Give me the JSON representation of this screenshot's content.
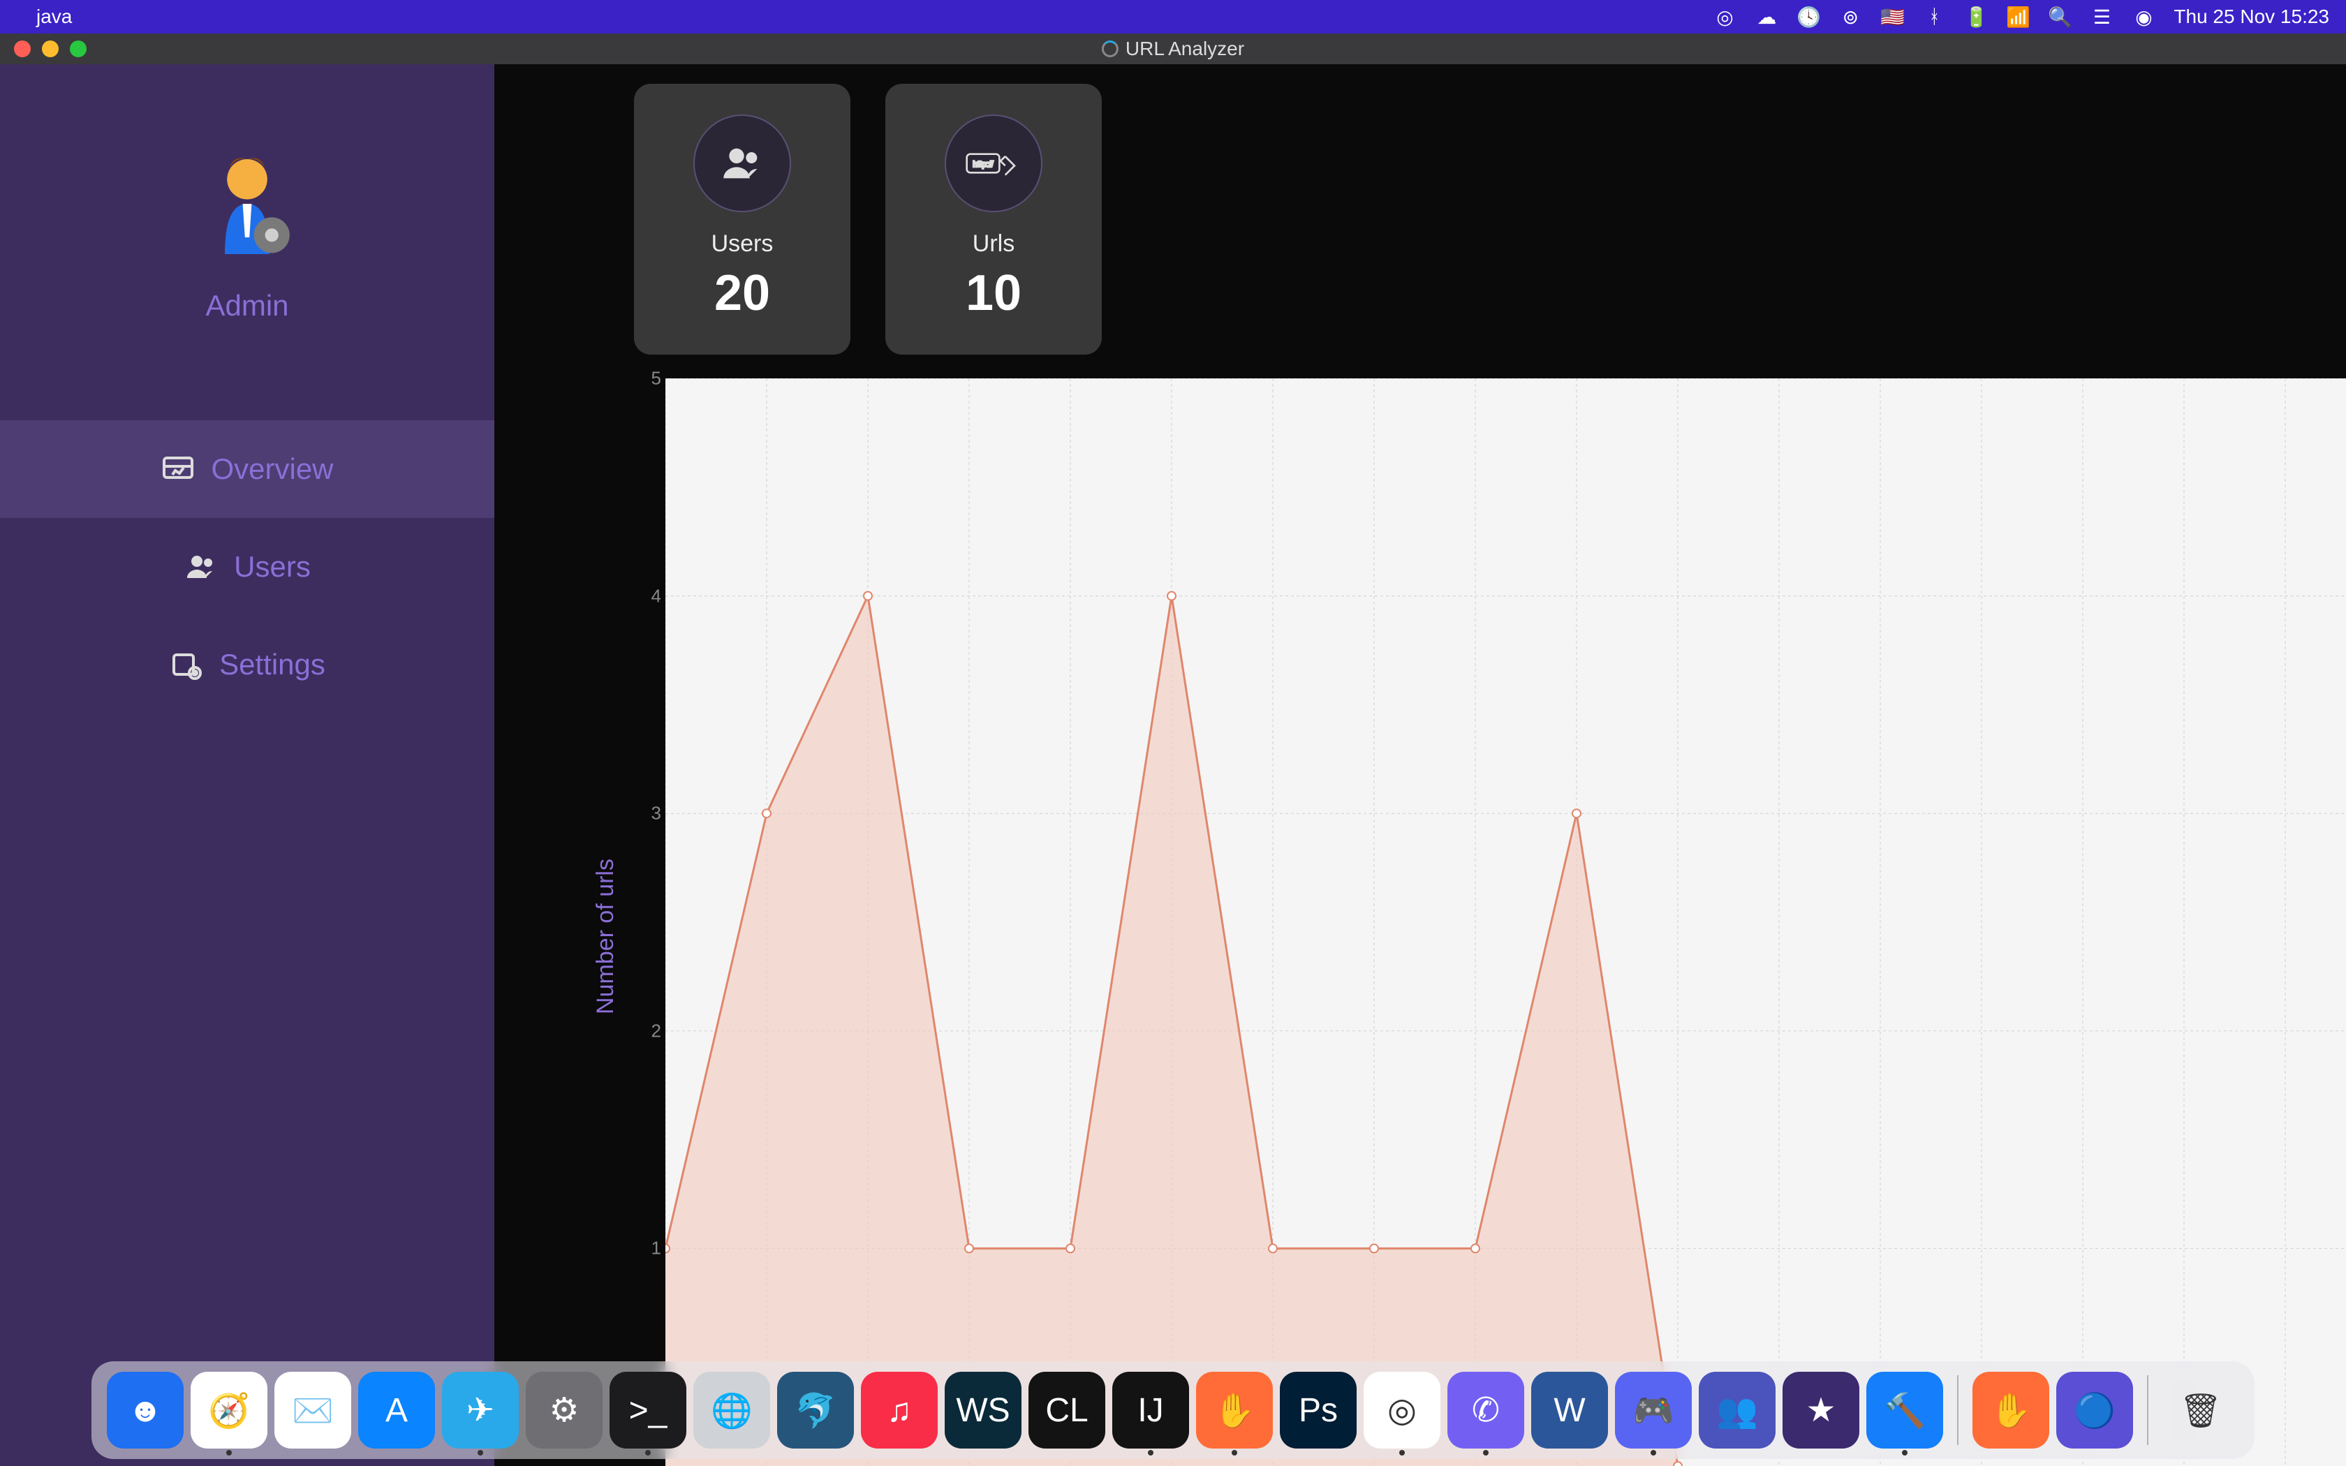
{
  "menubar": {
    "app_name": "java",
    "date_time": "Thu 25 Nov  15:23"
  },
  "window": {
    "title": "URL Analyzer"
  },
  "sidebar": {
    "user_label": "Admin",
    "nav": {
      "overview": "Overview",
      "users": "Users",
      "settings": "Settings"
    }
  },
  "cards": {
    "users": {
      "label": "Users",
      "value": "20"
    },
    "urls": {
      "label": "Urls",
      "value": "10"
    }
  },
  "chart_data": {
    "type": "area",
    "ylabel": "Number of urls",
    "xlabel": "",
    "ylim": [
      0,
      5
    ],
    "x": [
      0,
      1,
      2,
      3,
      4,
      5,
      6,
      7,
      8,
      9,
      10
    ],
    "values": [
      1,
      3,
      4,
      1,
      1,
      4,
      1,
      1,
      1,
      3,
      0
    ],
    "stroke": "#e0866c",
    "fill": "#f2c9bd",
    "yticks": [
      1,
      2,
      3,
      4,
      5
    ]
  },
  "dock": {
    "items": [
      {
        "name": "finder",
        "bg": "#1e6ff2",
        "glyph": "☻"
      },
      {
        "name": "safari",
        "bg": "#ffffff",
        "glyph": "🧭",
        "running": true
      },
      {
        "name": "mail",
        "bg": "#ffffff",
        "glyph": "✉️"
      },
      {
        "name": "app-store",
        "bg": "#0a84ff",
        "glyph": "A"
      },
      {
        "name": "telegram",
        "bg": "#29a9ea",
        "glyph": "✈",
        "running": true
      },
      {
        "name": "system-prefs",
        "bg": "#6e6e73",
        "glyph": "⚙"
      },
      {
        "name": "terminal",
        "bg": "#1c1c1e",
        "glyph": ">_",
        "running": true
      },
      {
        "name": "google-earth",
        "bg": "#cfd2d6",
        "glyph": "🌐"
      },
      {
        "name": "mysql-wb",
        "bg": "#26557c",
        "glyph": "🐬"
      },
      {
        "name": "apple-music",
        "bg": "#fa2d48",
        "glyph": "♫"
      },
      {
        "name": "webstorm",
        "bg": "#0a2a3a",
        "glyph": "WS"
      },
      {
        "name": "clion",
        "bg": "#131313",
        "glyph": "CL"
      },
      {
        "name": "intellij",
        "bg": "#131313",
        "glyph": "IJ",
        "running": true
      },
      {
        "name": "postman",
        "bg": "#ff6c37",
        "glyph": "✋",
        "running": true
      },
      {
        "name": "photoshop",
        "bg": "#001e36",
        "glyph": "Ps"
      },
      {
        "name": "chrome",
        "bg": "#ffffff",
        "glyph": "◎",
        "running": true
      },
      {
        "name": "viber",
        "bg": "#7360f2",
        "glyph": "✆",
        "running": true
      },
      {
        "name": "word",
        "bg": "#2b579a",
        "glyph": "W"
      },
      {
        "name": "discord",
        "bg": "#5865f2",
        "glyph": "🎮",
        "running": true
      },
      {
        "name": "teams",
        "bg": "#4b53bc",
        "glyph": "👥"
      },
      {
        "name": "imovie",
        "bg": "#3b2a6e",
        "glyph": "★"
      },
      {
        "name": "xcode",
        "bg": "#147efb",
        "glyph": "🔨",
        "running": true
      }
    ],
    "items_after_sep": [
      {
        "name": "postman-2",
        "bg": "#ff6c37",
        "glyph": "✋"
      },
      {
        "name": "safari-tp",
        "bg": "#5b4fd6",
        "glyph": "🔵"
      }
    ],
    "trash": {
      "name": "trash",
      "bg": "transparent",
      "glyph": "🗑"
    }
  }
}
